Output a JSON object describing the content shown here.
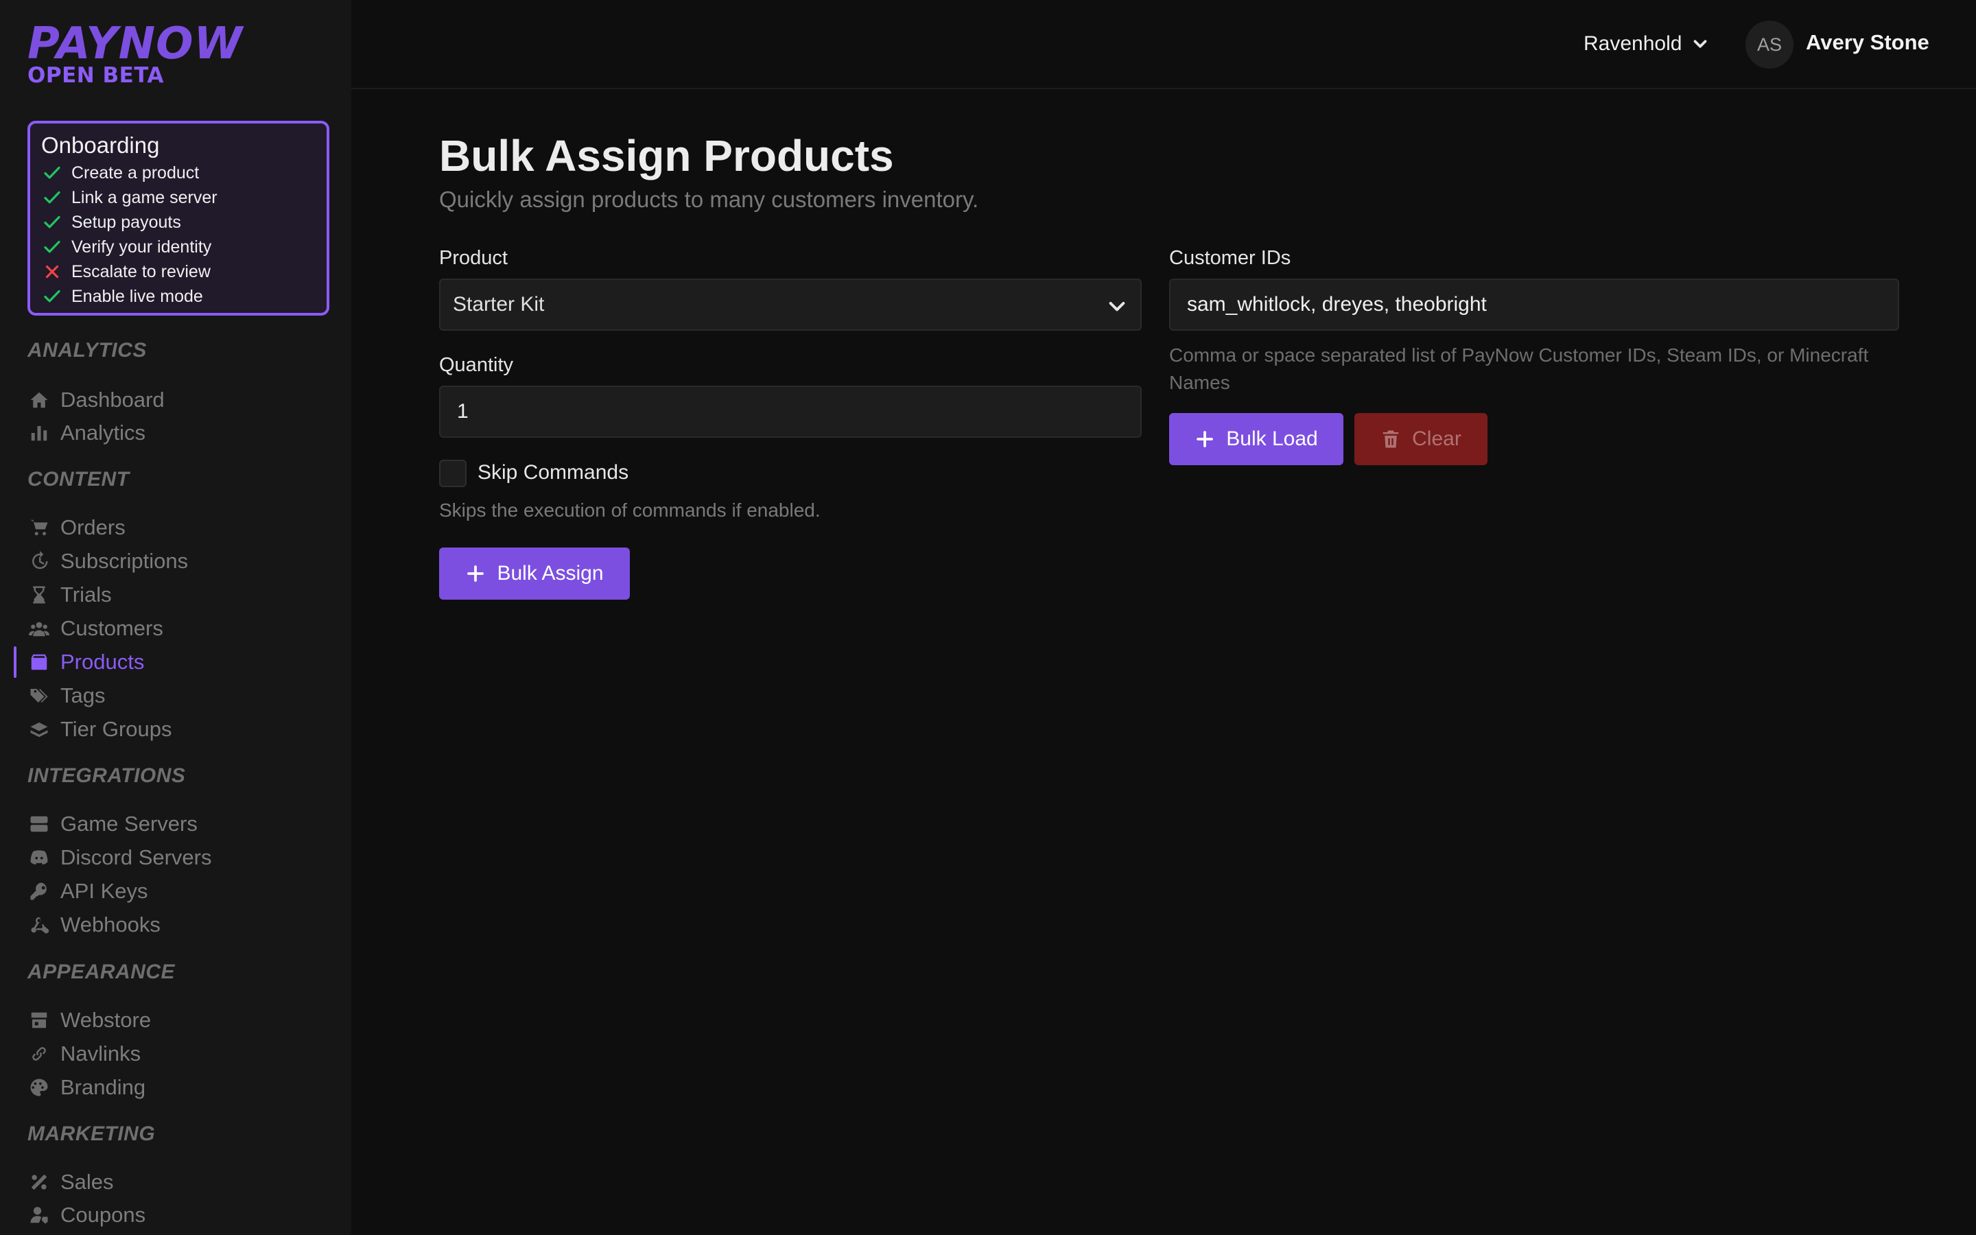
{
  "brand": {
    "name": "PAYNOW",
    "tagline": "OPEN BETA"
  },
  "onboarding": {
    "title": "Onboarding",
    "items": [
      {
        "label": "Create a product",
        "done": true
      },
      {
        "label": "Link a game server",
        "done": true
      },
      {
        "label": "Setup payouts",
        "done": true
      },
      {
        "label": "Verify your identity",
        "done": true
      },
      {
        "label": "Escalate to review",
        "done": false
      },
      {
        "label": "Enable live mode",
        "done": true
      }
    ]
  },
  "sidebar": {
    "sections": [
      {
        "title": "ANALYTICS",
        "items": [
          {
            "label": "Dashboard",
            "icon": "home-icon"
          },
          {
            "label": "Analytics",
            "icon": "bar-chart-icon"
          }
        ]
      },
      {
        "title": "CONTENT",
        "items": [
          {
            "label": "Orders",
            "icon": "cart-icon"
          },
          {
            "label": "Subscriptions",
            "icon": "history-icon"
          },
          {
            "label": "Trials",
            "icon": "hourglass-icon"
          },
          {
            "label": "Customers",
            "icon": "users-icon"
          },
          {
            "label": "Products",
            "icon": "box-icon",
            "active": true
          },
          {
            "label": "Tags",
            "icon": "tags-icon"
          },
          {
            "label": "Tier Groups",
            "icon": "layers-icon"
          }
        ]
      },
      {
        "title": "INTEGRATIONS",
        "items": [
          {
            "label": "Game Servers",
            "icon": "server-icon"
          },
          {
            "label": "Discord Servers",
            "icon": "discord-icon"
          },
          {
            "label": "API Keys",
            "icon": "key-icon"
          },
          {
            "label": "Webhooks",
            "icon": "webhook-icon"
          }
        ]
      },
      {
        "title": "APPEARANCE",
        "items": [
          {
            "label": "Webstore",
            "icon": "store-icon"
          },
          {
            "label": "Navlinks",
            "icon": "link-icon"
          },
          {
            "label": "Branding",
            "icon": "palette-icon"
          }
        ]
      },
      {
        "title": "MARKETING",
        "items": [
          {
            "label": "Sales",
            "icon": "percent-icon"
          },
          {
            "label": "Coupons",
            "icon": "user-tag-icon"
          }
        ]
      }
    ]
  },
  "header": {
    "store": "Ravenhold",
    "user_initials": "AS",
    "user_name": "Avery Stone"
  },
  "page": {
    "title": "Bulk Assign Products",
    "subtitle": "Quickly assign products to many customers inventory.",
    "product_label": "Product",
    "product_value": "Starter Kit",
    "quantity_label": "Quantity",
    "quantity_value": "1",
    "skip_label": "Skip Commands",
    "skip_help": "Skips the execution of commands if enabled.",
    "assign_button": "Bulk Assign",
    "ids_label": "Customer IDs",
    "ids_value": "sam_whitlock, dreyes, theobright",
    "ids_help": "Comma or space separated list of PayNow Customer IDs, Steam IDs, or Minecraft Names",
    "load_button": "Bulk Load",
    "clear_button": "Clear"
  },
  "colors": {
    "accent": "#7c4fe0",
    "danger": "#7a1c1c",
    "success": "#22c55e",
    "error": "#ef4444"
  }
}
